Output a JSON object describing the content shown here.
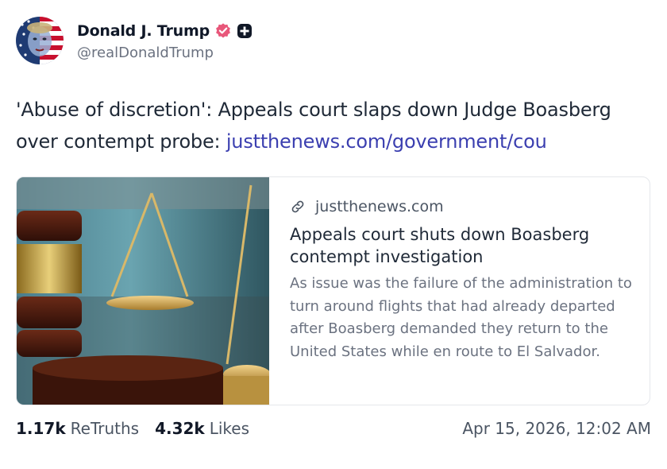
{
  "post": {
    "author": {
      "display_name": "Donald J. Trump",
      "handle": "@realDonaldTrump",
      "verified_icon": "verified-badge-icon",
      "extra_badge_icon": "plus-badge-icon",
      "avatar": "avatar-image"
    },
    "text": {
      "body": "'Abuse of discretion': Appeals court slaps down Judge Boasberg over contempt probe: ",
      "link": "justthenews.com/government/cou"
    },
    "link_card": {
      "image": "gavel-and-scales-image",
      "domain_icon": "link-icon",
      "domain": "justthenews.com",
      "title": "Appeals court shuts down Boasberg contempt investigation",
      "description": "As issue was the failure of the administration to turn around flights that had already departed after Boasberg demanded they return to the United States while en route to El Salvador."
    },
    "stats": {
      "retruths_count": "1.17k",
      "retruths_label": "ReTruths",
      "likes_count": "4.32k",
      "likes_label": "Likes"
    },
    "timestamp": "Apr 15, 2026, 12:02 AM"
  },
  "colors": {
    "link": "#3b3fb0",
    "verified_badge": "#e8577a",
    "text_primary": "#1f2937",
    "text_secondary": "#6b7280"
  }
}
